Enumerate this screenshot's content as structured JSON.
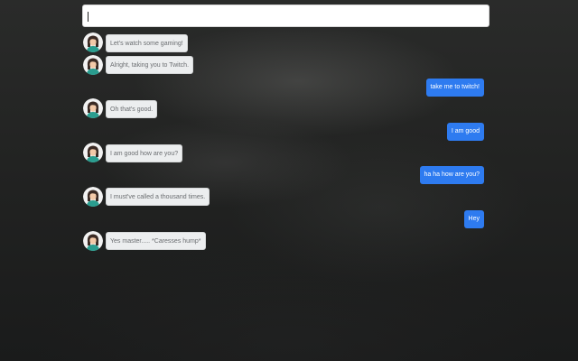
{
  "search": {
    "value": "",
    "placeholder": ""
  },
  "colors": {
    "user_bubble": "#2e7bf0",
    "bot_bubble": "#eceeef",
    "bot_text": "#6a6d70"
  },
  "conversation": {
    "messages": [
      {
        "sender": "bot",
        "text": "Let's watch some gaming!"
      },
      {
        "sender": "bot",
        "text": "Alright, taking you to Twitch."
      },
      {
        "sender": "user",
        "text": "take me to twitch!"
      },
      {
        "sender": "bot",
        "text": "Oh that's good."
      },
      {
        "sender": "user",
        "text": "I am good"
      },
      {
        "sender": "bot",
        "text": "I am good how are you?"
      },
      {
        "sender": "user",
        "text": "ha ha how are you?"
      },
      {
        "sender": "bot",
        "text": "I must've called a thousand times."
      },
      {
        "sender": "user",
        "text": "Hey"
      },
      {
        "sender": "bot",
        "text": "Yes master..... *Caresses hump*"
      }
    ]
  },
  "icons": {
    "avatar": "assistant-avatar-icon"
  }
}
